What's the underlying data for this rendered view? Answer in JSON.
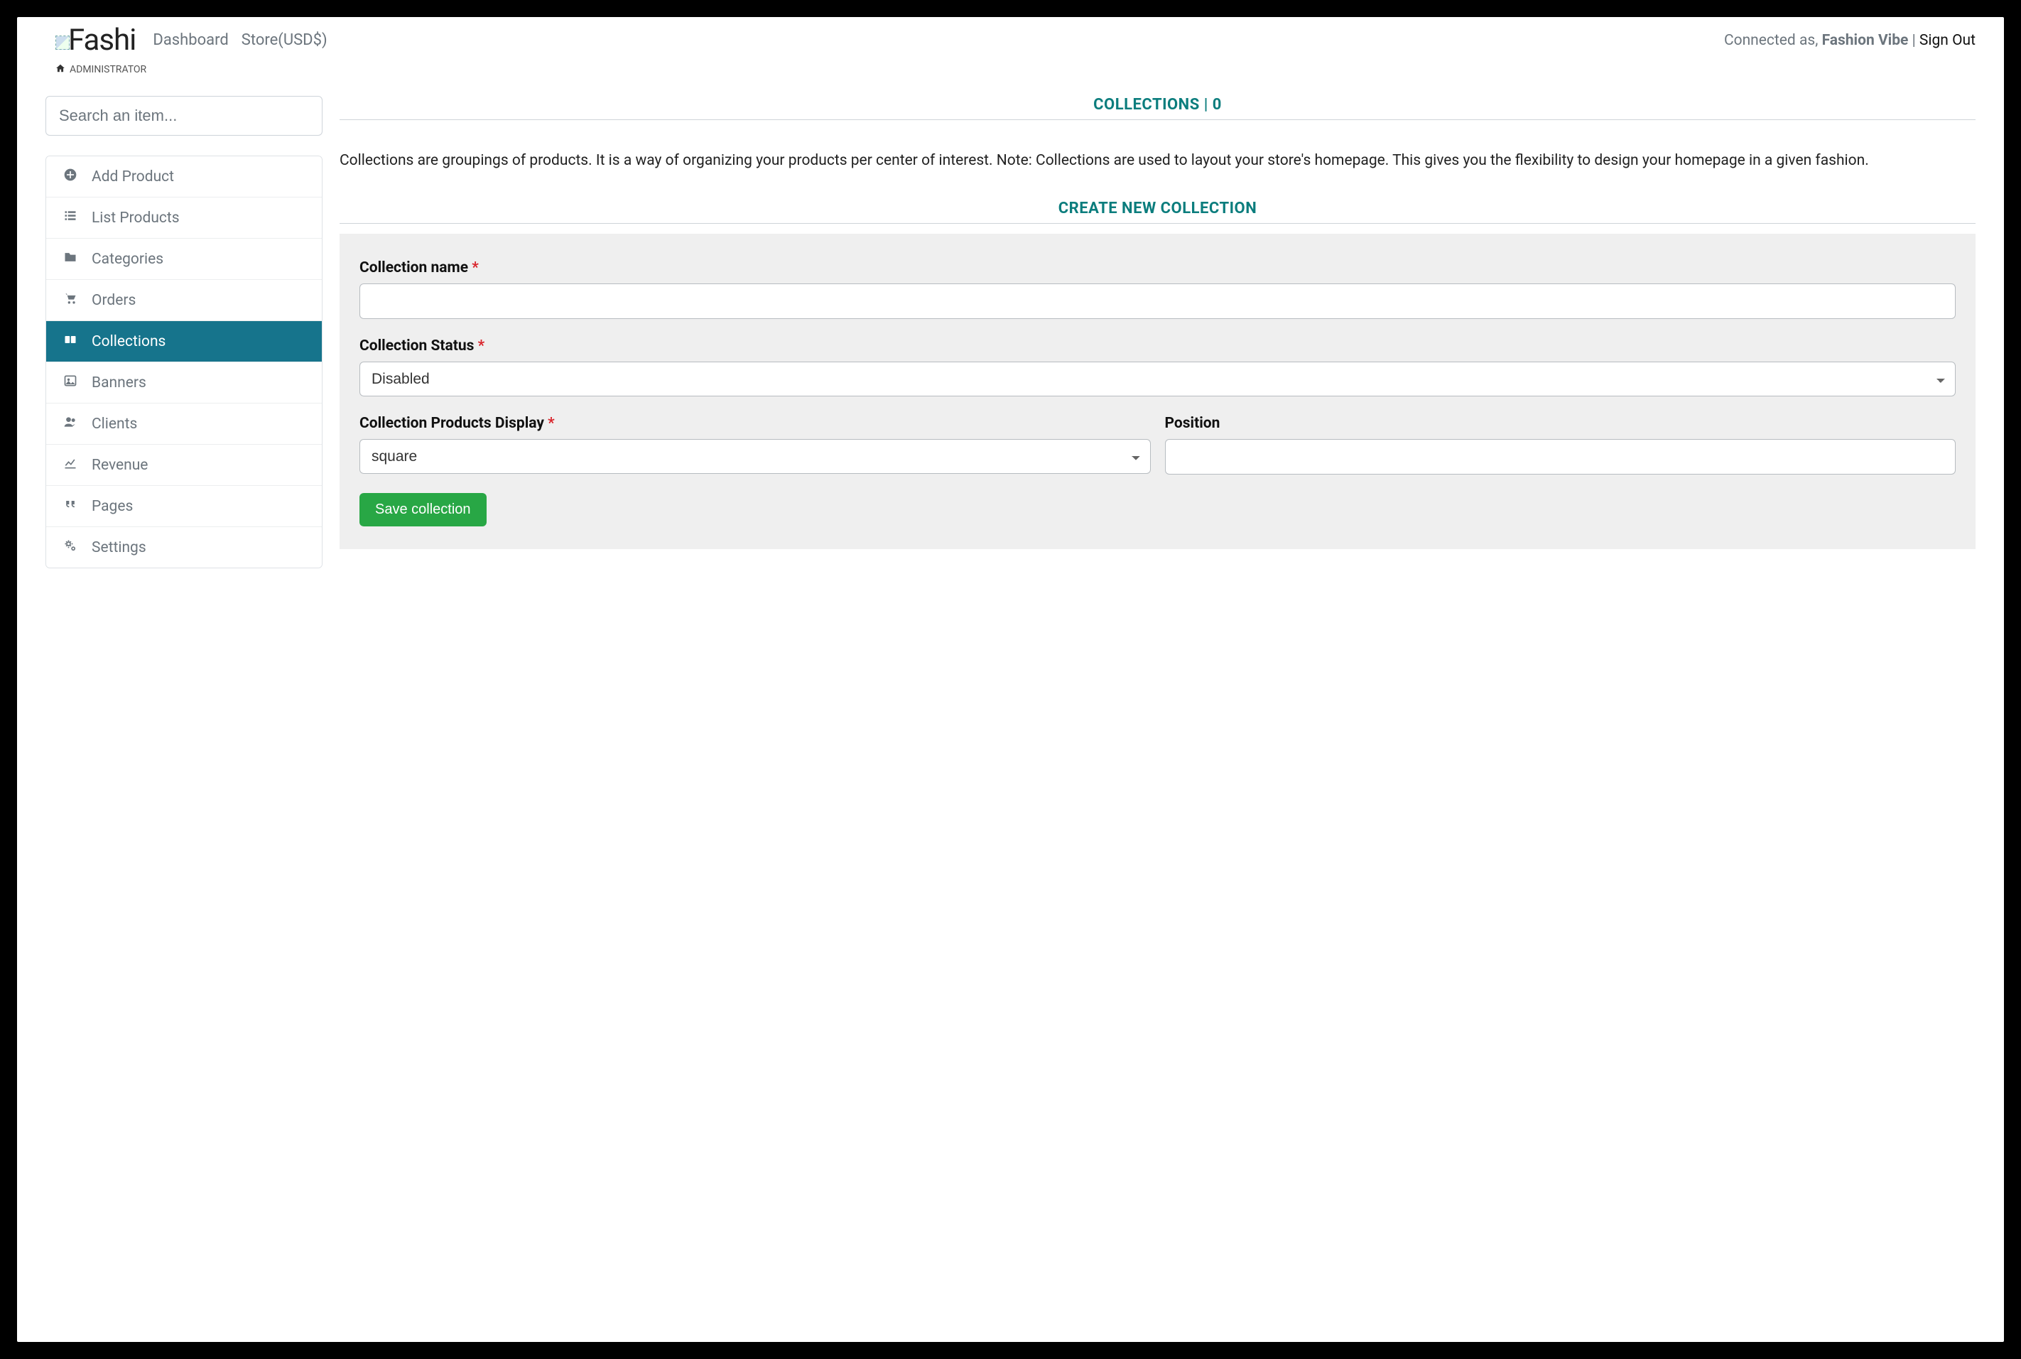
{
  "brand": "Fashi",
  "nav": {
    "dashboard": "Dashboard",
    "store": "Store(USD$)"
  },
  "breadcrumb": {
    "label": "ADMINISTRATOR"
  },
  "topright": {
    "connected_as": "Connected as, ",
    "user": "Fashion Vibe",
    "sep": " | ",
    "signout": "Sign Out"
  },
  "search": {
    "placeholder": "Search an item..."
  },
  "sidebar": {
    "items": [
      {
        "label": "Add Product"
      },
      {
        "label": "List Products"
      },
      {
        "label": "Categories"
      },
      {
        "label": "Orders"
      },
      {
        "label": "Collections"
      },
      {
        "label": "Banners"
      },
      {
        "label": "Clients"
      },
      {
        "label": "Revenue"
      },
      {
        "label": "Pages"
      },
      {
        "label": "Settings"
      }
    ]
  },
  "collections": {
    "title": "COLLECTIONS | 0",
    "description": "Collections are groupings of products. It is a way of organizing your products per center of interest. Note: Collections are used to layout your store's homepage. This gives you the flexibility to design your homepage in a given fashion."
  },
  "create": {
    "title": "CREATE NEW COLLECTION",
    "name_label": "Collection name ",
    "status_label": "Collection Status ",
    "status_value": "Disabled",
    "display_label": "Collection Products Display ",
    "display_value": "square",
    "position_label": "Position",
    "required_mark": "*",
    "save_button": "Save collection"
  }
}
